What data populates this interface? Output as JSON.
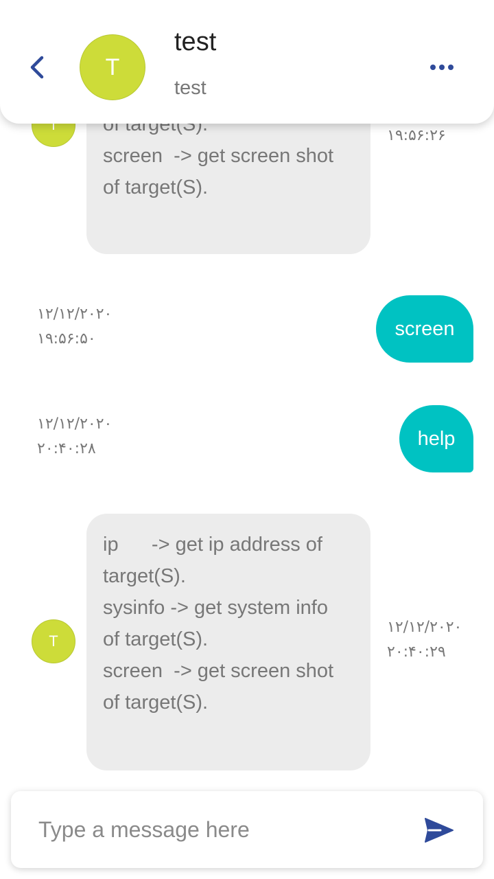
{
  "header": {
    "contact_name": "test",
    "contact_status": "test",
    "avatar_initial": "T"
  },
  "messages": [
    {
      "direction": "incoming",
      "avatar_initial": "T",
      "lines": [
        "of target(S).",
        "screen  -> get screen shot",
        "of target(S)."
      ],
      "date": "",
      "time": "۱۹:۵۶:۲۶"
    },
    {
      "direction": "outgoing",
      "text": "screen",
      "date": "۱۲/۱۲/۲۰۲۰",
      "time": "۱۹:۵۶:۵۰"
    },
    {
      "direction": "outgoing",
      "text": "help",
      "date": "۱۲/۱۲/۲۰۲۰",
      "time": "۲۰:۴۰:۲۸"
    },
    {
      "direction": "incoming",
      "avatar_initial": "T",
      "lines": [
        "ip      -> get ip address of",
        "target(S).",
        "sysinfo -> get system info",
        "of target(S).",
        "screen  -> get screen shot",
        "of target(S)."
      ],
      "date": "۱۲/۱۲/۲۰۲۰",
      "time": "۲۰:۴۰:۲۹"
    }
  ],
  "composer": {
    "placeholder": "Type a message here",
    "value": ""
  },
  "colors": {
    "accent_teal": "#00c2c2",
    "avatar_lime": "#cddc39",
    "icon_blue": "#2f4a9a",
    "bubble_grey": "#ececec"
  },
  "icons": {
    "back": "chevron-left-icon",
    "more": "more-horizontal-icon",
    "send": "send-icon"
  }
}
